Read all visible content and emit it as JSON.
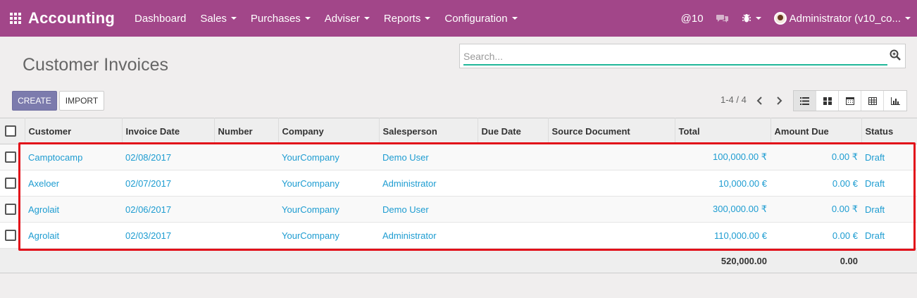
{
  "navbar": {
    "brand": "Accounting",
    "menu": [
      {
        "label": "Dashboard",
        "dropdown": false
      },
      {
        "label": "Sales",
        "dropdown": true
      },
      {
        "label": "Purchases",
        "dropdown": true
      },
      {
        "label": "Adviser",
        "dropdown": true
      },
      {
        "label": "Reports",
        "dropdown": true
      },
      {
        "label": "Configuration",
        "dropdown": true
      }
    ],
    "mentions_label": "@10",
    "user_label": "Administrator (v10_co..."
  },
  "control_panel": {
    "title": "Customer Invoices",
    "search_placeholder": "Search...",
    "create_label": "CREATE",
    "import_label": "IMPORT",
    "pager_value": "1-4 / 4"
  },
  "table": {
    "columns": [
      "Customer",
      "Invoice Date",
      "Number",
      "Company",
      "Salesperson",
      "Due Date",
      "Source Document",
      "Total",
      "Amount Due",
      "Status"
    ],
    "rows": [
      {
        "customer": "Camptocamp",
        "invoice_date": "02/08/2017",
        "number": "",
        "company": "YourCompany",
        "salesperson": "Demo User",
        "due_date": "",
        "source_document": "",
        "total": "100,000.00 ₹",
        "amount_due": "0.00 ₹",
        "status": "Draft"
      },
      {
        "customer": "Axeloer",
        "invoice_date": "02/07/2017",
        "number": "",
        "company": "YourCompany",
        "salesperson": "Administrator",
        "due_date": "",
        "source_document": "",
        "total": "10,000.00 €",
        "amount_due": "0.00 €",
        "status": "Draft"
      },
      {
        "customer": "Agrolait",
        "invoice_date": "02/06/2017",
        "number": "",
        "company": "YourCompany",
        "salesperson": "Demo User",
        "due_date": "",
        "source_document": "",
        "total": "300,000.00 ₹",
        "amount_due": "0.00 ₹",
        "status": "Draft"
      },
      {
        "customer": "Agrolait",
        "invoice_date": "02/03/2017",
        "number": "",
        "company": "YourCompany",
        "salesperson": "Administrator",
        "due_date": "",
        "source_document": "",
        "total": "110,000.00 €",
        "amount_due": "0.00 €",
        "status": "Draft"
      }
    ],
    "footer": {
      "total": "520,000.00",
      "amount_due": "0.00"
    }
  },
  "colors": {
    "navbar": "#a24689",
    "primary_button": "#7c7bad",
    "link": "#1d9cd1",
    "highlight_border": "#e2111a"
  }
}
